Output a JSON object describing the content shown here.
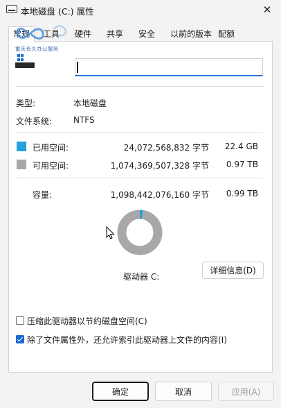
{
  "window": {
    "title": "本地磁盘 (C:) 属性",
    "close_symbol": "✕"
  },
  "watermark": {
    "text": "重庆长久办公服务"
  },
  "tabs": [
    {
      "label": "常规"
    },
    {
      "label": "工具"
    },
    {
      "label": "硬件"
    },
    {
      "label": "共享"
    },
    {
      "label": "安全"
    },
    {
      "label": "以前的版本"
    },
    {
      "label": "配额"
    }
  ],
  "general": {
    "name_value": "",
    "type_label": "类型:",
    "type_value": "本地磁盘",
    "fs_label": "文件系统:",
    "fs_value": "NTFS",
    "used": {
      "label": "已用空间:",
      "bytes": "24,072,568,832 字节",
      "size": "22.4 GB",
      "color": "#26a0da"
    },
    "free": {
      "label": "可用空间:",
      "bytes": "1,074,369,507,328 字节",
      "size": "0.97 TB",
      "color": "#a8a8a8"
    },
    "capacity": {
      "label": "容量:",
      "bytes": "1,098,442,076,160 字节",
      "size": "0.99 TB"
    },
    "used_fraction": 0.0219,
    "drive_label": "驱动器 C:",
    "details_button": "详细信息(D)",
    "compress_label": "压缩此驱动器以节约磁盘空间(C)",
    "compress_checked": false,
    "index_label": "除了文件属性外，还允许索引此驱动器上文件的内容(I)",
    "index_checked": true
  },
  "footer": {
    "ok": "确定",
    "cancel": "取消",
    "apply": "应用(A)"
  }
}
